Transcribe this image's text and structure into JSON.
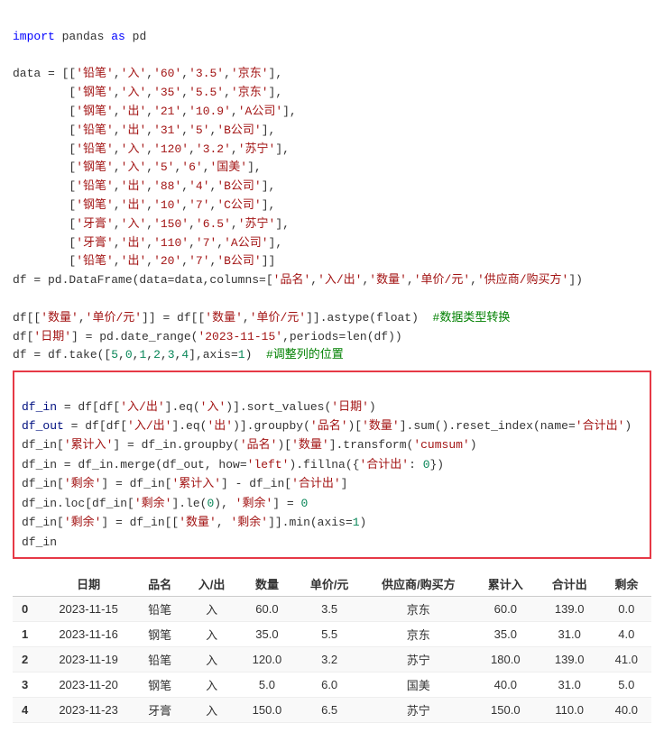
{
  "code": {
    "import_line": "import pandas as pd",
    "comment_data_type": "#数据类型转换",
    "comment_adjust_pos": "#调整列的位置",
    "highlighted_code_lines": [
      "df_in = df[df['入/出'].eq('入')].sort_values('日期')",
      "df_out = df[df['入/出'].eq('出')].groupby('品名')['数量'].sum().reset_index(name='合计出')",
      "df_in['累计入'] = df_in.groupby('品名')['数量'].transform('cumsum')",
      "df_in = df_in.merge(df_out, how='left').fillna({'合计出': 0})",
      "df_in['剩余'] = df_in['累计入'] - df_in['合计出']",
      "df_in.loc[df_in['剩余'].le(0), '剩余'] = 0",
      "df_in['剩余'] = df_in[['数量', '剩余']].min(axis=1)",
      "df_in"
    ]
  },
  "table": {
    "headers": [
      "",
      "日期",
      "品名",
      "入/出",
      "数量",
      "单价/元",
      "供应商/购买方",
      "累计入",
      "合计出",
      "剩余"
    ],
    "rows": [
      [
        "0",
        "2023-11-15",
        "铅笔",
        "入",
        "60.0",
        "3.5",
        "京东",
        "60.0",
        "139.0",
        "0.0"
      ],
      [
        "1",
        "2023-11-16",
        "钢笔",
        "入",
        "35.0",
        "5.5",
        "京东",
        "35.0",
        "31.0",
        "4.0"
      ],
      [
        "2",
        "2023-11-19",
        "铅笔",
        "入",
        "120.0",
        "3.2",
        "苏宁",
        "180.0",
        "139.0",
        "41.0"
      ],
      [
        "3",
        "2023-11-20",
        "钢笔",
        "入",
        "5.0",
        "6.0",
        "国美",
        "40.0",
        "31.0",
        "5.0"
      ],
      [
        "4",
        "2023-11-23",
        "牙膏",
        "入",
        "150.0",
        "6.5",
        "苏宁",
        "150.0",
        "110.0",
        "40.0"
      ]
    ]
  }
}
